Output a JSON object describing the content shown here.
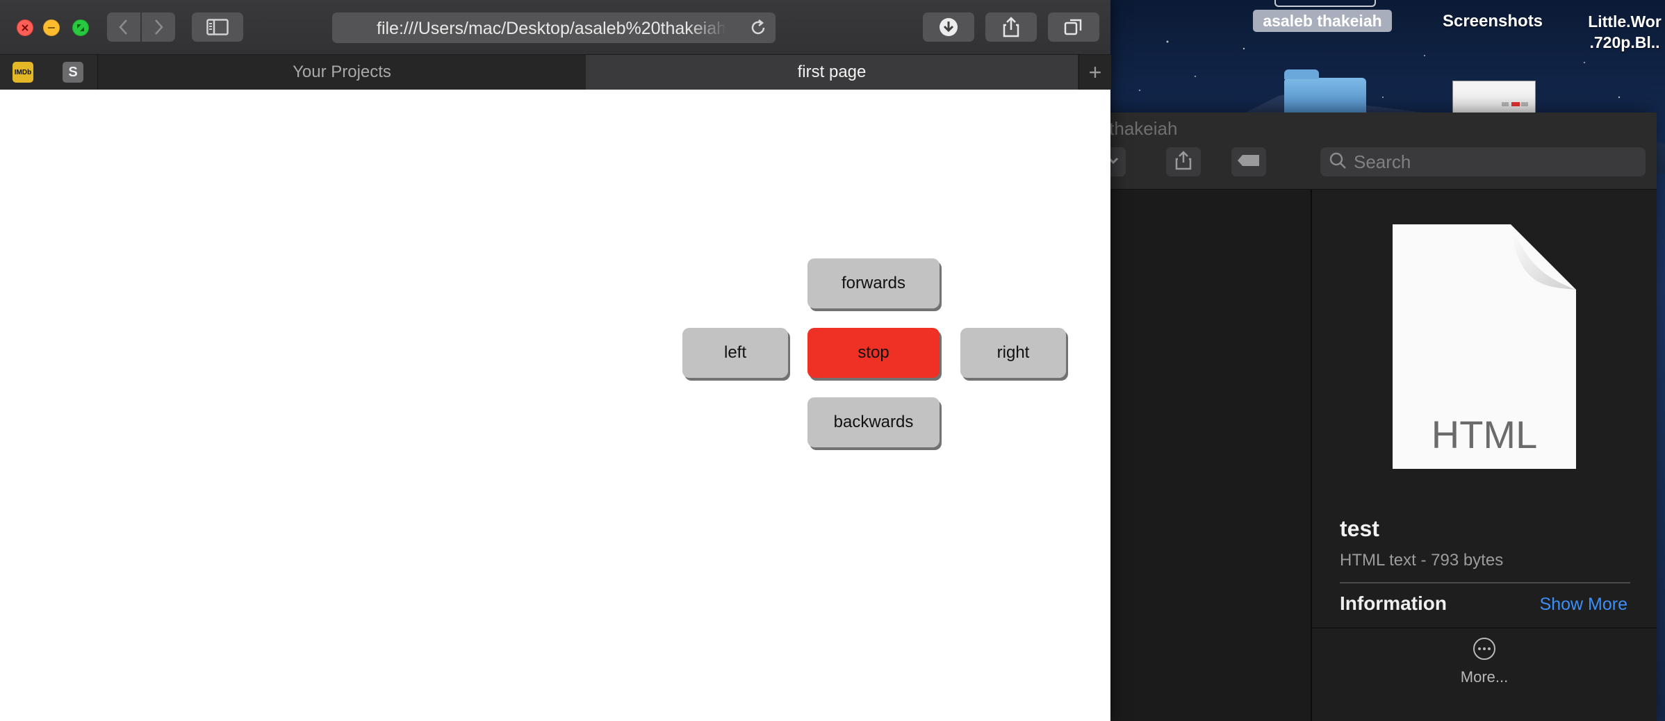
{
  "desktop": {
    "labels": {
      "folder": "asaleb thakeiah",
      "screenshots": "Screenshots",
      "video_line1": "Little.Wor",
      "video_line2": ".720p.Bl.."
    }
  },
  "browser": {
    "address": "file:///Users/mac/Desktop/asaleb%20thakeiah",
    "favorites": [
      "IMDb",
      "S"
    ],
    "tabs": [
      {
        "label": "Your Projects",
        "active": false
      },
      {
        "label": "first page",
        "active": true
      }
    ],
    "new_tab_glyph": "+"
  },
  "controls": {
    "forwards": "forwards",
    "left": "left",
    "stop": "stop",
    "right": "right",
    "backwards": "backwards",
    "colors": {
      "button": "#c2c2c2",
      "stop": "#ee3124"
    }
  },
  "finder": {
    "title": "eb thakeiah",
    "search_placeholder": "Search",
    "preview": {
      "icon_label": "HTML",
      "file_name": "test",
      "file_kind": "HTML text - 793 bytes",
      "info_heading": "Information",
      "show_more": "Show More",
      "more_label": "More..."
    }
  }
}
